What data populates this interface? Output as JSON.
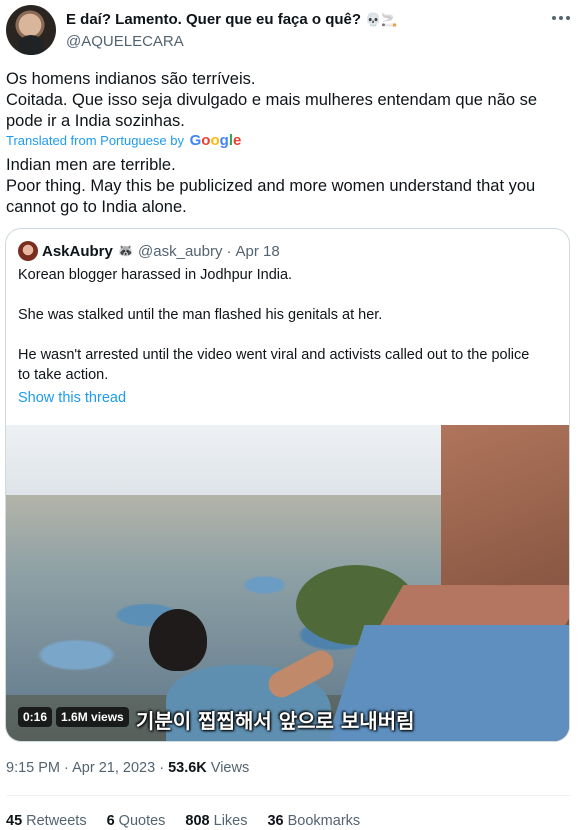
{
  "author": {
    "display_name": "E daí? Lamento. Quer que eu faça o quê?",
    "name_emoji": "💀🚬",
    "handle": "@AQUELECARA"
  },
  "tweet": {
    "original_lines": [
      "Os homens indianos são terríveis.",
      "Coitada. Que isso seja divulgado e mais mulheres entendam que não se pode ir a India sozinhas."
    ],
    "translated_from": "Translated from Portuguese by",
    "translator": "Google",
    "translation_lines": [
      "Indian men are terrible.",
      "Poor thing. May this be publicized and more women understand that you cannot go to India alone."
    ]
  },
  "quote": {
    "name": "AskAubry",
    "name_emoji": "🦝",
    "handle": "@ask_aubry",
    "separator": "·",
    "date": "Apr 18",
    "paragraphs": [
      "Korean blogger harassed in Jodhpur India.",
      "She was stalked until the man flashed his genitals at her.",
      "He wasn't arrested until the video went viral and activists called out to the police to take action."
    ],
    "show_thread": "Show this thread",
    "video": {
      "duration": "0:16",
      "views": "1.6M views",
      "subtitle": "기분이 찝찝해서 앞으로 보내버림"
    }
  },
  "meta": {
    "time": "9:15 PM",
    "separator1": "·",
    "date": "Apr 21, 2023",
    "separator2": "·",
    "views_count": "53.6K",
    "views_label": "Views"
  },
  "stats": [
    {
      "num": "45",
      "label": "Retweets"
    },
    {
      "num": "6",
      "label": "Quotes"
    },
    {
      "num": "808",
      "label": "Likes"
    },
    {
      "num": "36",
      "label": "Bookmarks"
    }
  ]
}
